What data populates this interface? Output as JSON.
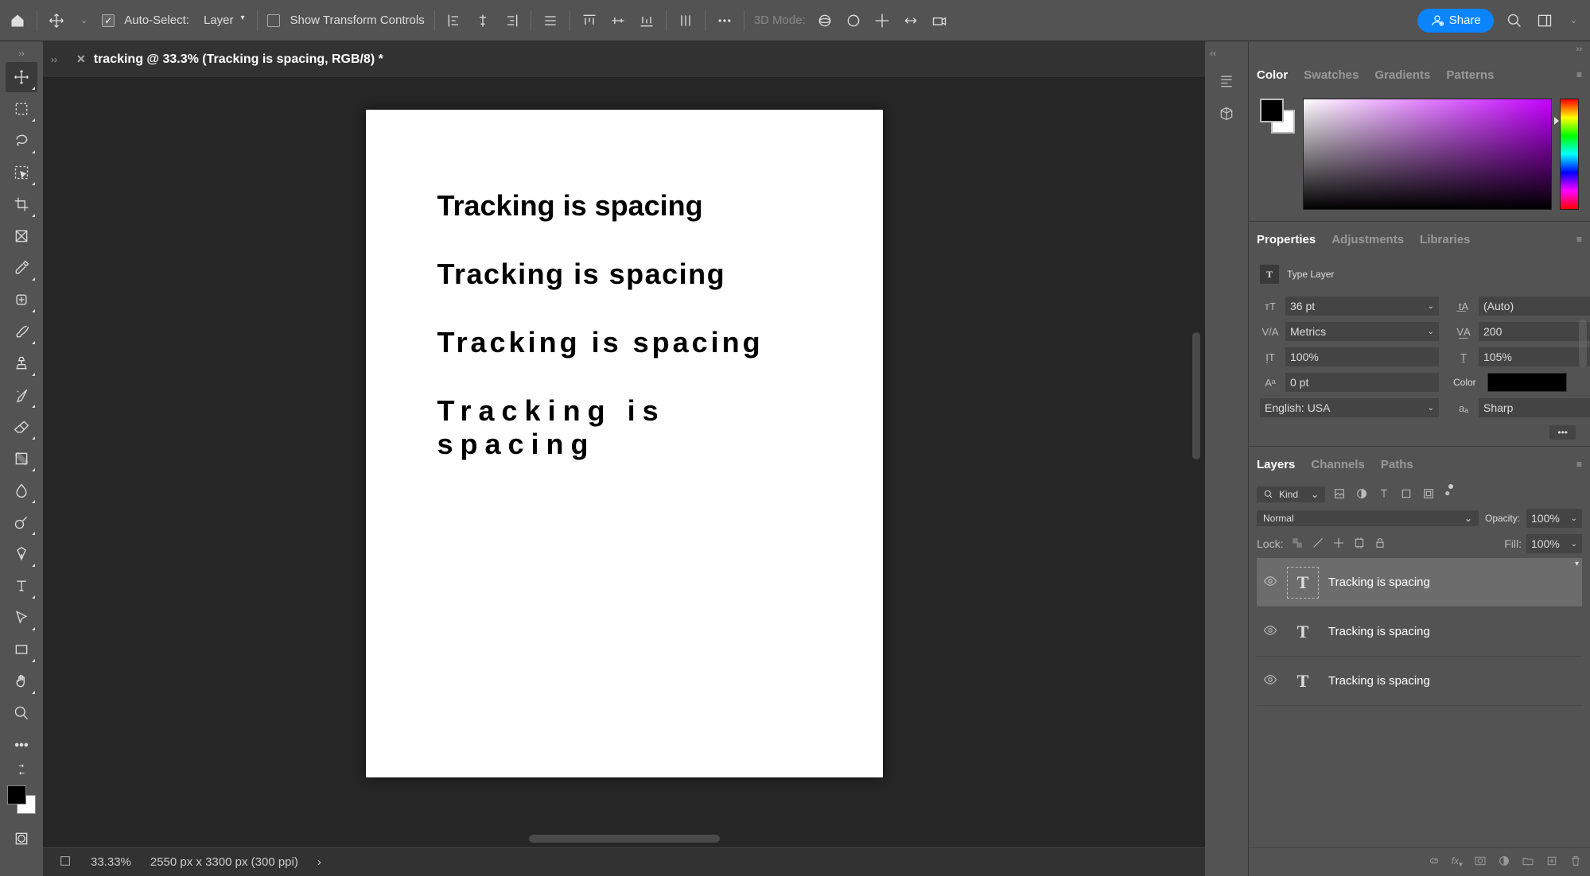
{
  "optionsBar": {
    "autoSelectLabel": "Auto-Select:",
    "autoSelectValue": "Layer",
    "showTransform": "Show Transform Controls",
    "modeLabel": "3D Mode:",
    "shareLabel": "Share"
  },
  "document": {
    "tabTitle": "tracking @ 33.3% (Tracking is spacing, RGB/8) *",
    "lines": [
      {
        "text": "Tracking is spacing",
        "ls": "0px"
      },
      {
        "text": "Tracking is spacing",
        "ls": "1.5px"
      },
      {
        "text": "Tracking is spacing",
        "ls": "4px"
      },
      {
        "text": "Tracking is spacing",
        "ls": "9px"
      }
    ]
  },
  "statusBar": {
    "zoom": "33.33%",
    "dims": "2550 px x 3300 px (300 ppi)"
  },
  "panels": {
    "color": {
      "tabs": [
        "Color",
        "Swatches",
        "Gradients",
        "Patterns"
      ],
      "active": 0
    },
    "properties": {
      "tabs": [
        "Properties",
        "Adjustments",
        "Libraries"
      ],
      "active": 0,
      "title": "Type Layer",
      "fontSize": "36 pt",
      "leading": "(Auto)",
      "kerning": "Metrics",
      "tracking": "200",
      "vscale": "100%",
      "hscale": "105%",
      "baseline": "0 pt",
      "colorLabel": "Color",
      "language": "English: USA",
      "antiAlias": "Sharp"
    },
    "layers": {
      "tabs": [
        "Layers",
        "Channels",
        "Paths"
      ],
      "active": 0,
      "kindLabel": "Kind",
      "blendMode": "Normal",
      "opacityLabel": "Opacity:",
      "opacityValue": "100%",
      "lockLabel": "Lock:",
      "fillLabel": "Fill:",
      "fillValue": "100%",
      "items": [
        {
          "name": "Tracking is spacing",
          "selected": true
        },
        {
          "name": "Tracking is spacing",
          "selected": false
        },
        {
          "name": "Tracking is spacing",
          "selected": false
        }
      ]
    }
  }
}
